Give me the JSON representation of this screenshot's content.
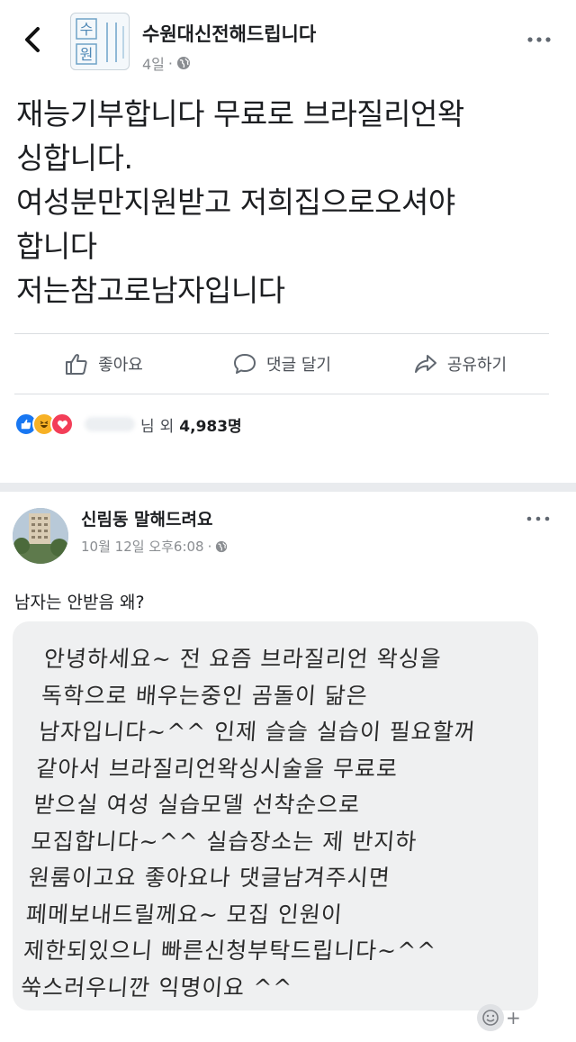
{
  "header": {
    "page_name": "수원대신전해드립니다",
    "time": "4일",
    "visibility_icon": "globe-icon",
    "back_icon": "chevron-left-icon",
    "more_icon": "more-horizontal-icon"
  },
  "post": {
    "lines": [
      "재능기부합니다 무료로 브라질리언왁",
      "싱합니다.",
      "여성분만지원받고 저희집으로오셔야",
      "합니다",
      "저는참고로남자입니다"
    ]
  },
  "actions": {
    "like_label": "좋아요",
    "comment_label": "댓글 달기",
    "share_label": "공유하기"
  },
  "reactions": {
    "partial_name": "님",
    "others_label": "외",
    "count": "4,983명",
    "colors": {
      "like": "#1877f2",
      "haha": "#f7b125",
      "love": "#f33e58"
    }
  },
  "shared_post": {
    "author": "신림동 말해드려요",
    "date": "10월 12일 오후6:08",
    "dot": "·",
    "caption": "남자는 안받음 왜?",
    "note_lines": [
      "안녕하세요~ 전 요즘 브라질리언 왁싱을",
      "독학으로 배우는중인 곰돌이 닮은",
      "남자입니다~^^ 인제 슬슬 실습이 필요할꺼",
      "같아서 브라질리언왁싱시술을 무료로",
      "받으실 여성 실습모델 선착순으로",
      "모집합니다~^^ 실습장소는 제 반지하",
      "원룸이고요 좋아요나 댓글남겨주시면",
      "페메보내드릴께요~ 모집 인원이",
      "제한되있으니 빠른신청부탁드립니다~^^",
      "쑥스러우니깐 익명이요 ^^"
    ],
    "emoji_plus": "+"
  },
  "page_avatar_text": [
    "수",
    "원"
  ]
}
